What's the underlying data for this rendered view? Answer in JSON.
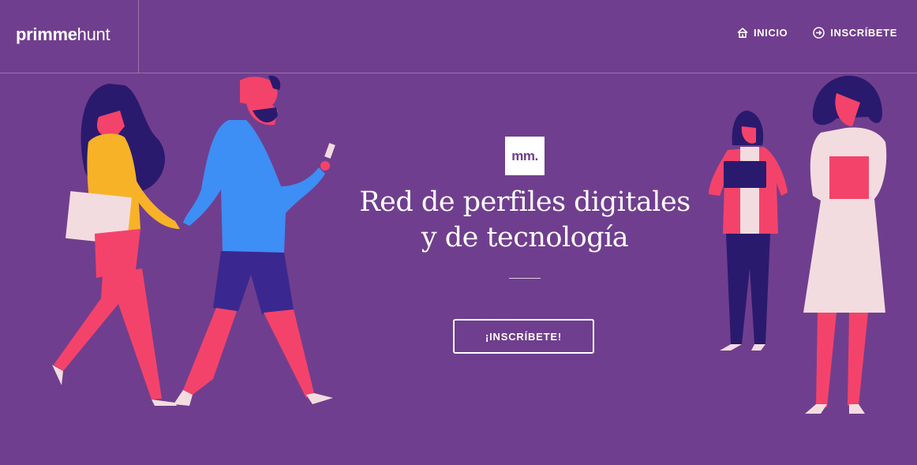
{
  "brand": {
    "logo_bold": "primme",
    "logo_light": "hunt"
  },
  "nav": [
    {
      "label": "INICIO",
      "icon": "home-icon"
    },
    {
      "label": "INSCRÍBETE",
      "icon": "arrow-circle-right-icon"
    }
  ],
  "hero": {
    "badge": "mm.",
    "title_line1": "Red de perfiles digitales",
    "title_line2": "y de tecnología",
    "cta_label": "¡INSCRÍBETE!"
  },
  "colors": {
    "background": "#703e8e",
    "accent_pink": "#f4436a",
    "yellow": "#f7b228",
    "blue": "#3d8ef5",
    "navy": "#2a1a6e",
    "cream": "#f3dce0"
  }
}
